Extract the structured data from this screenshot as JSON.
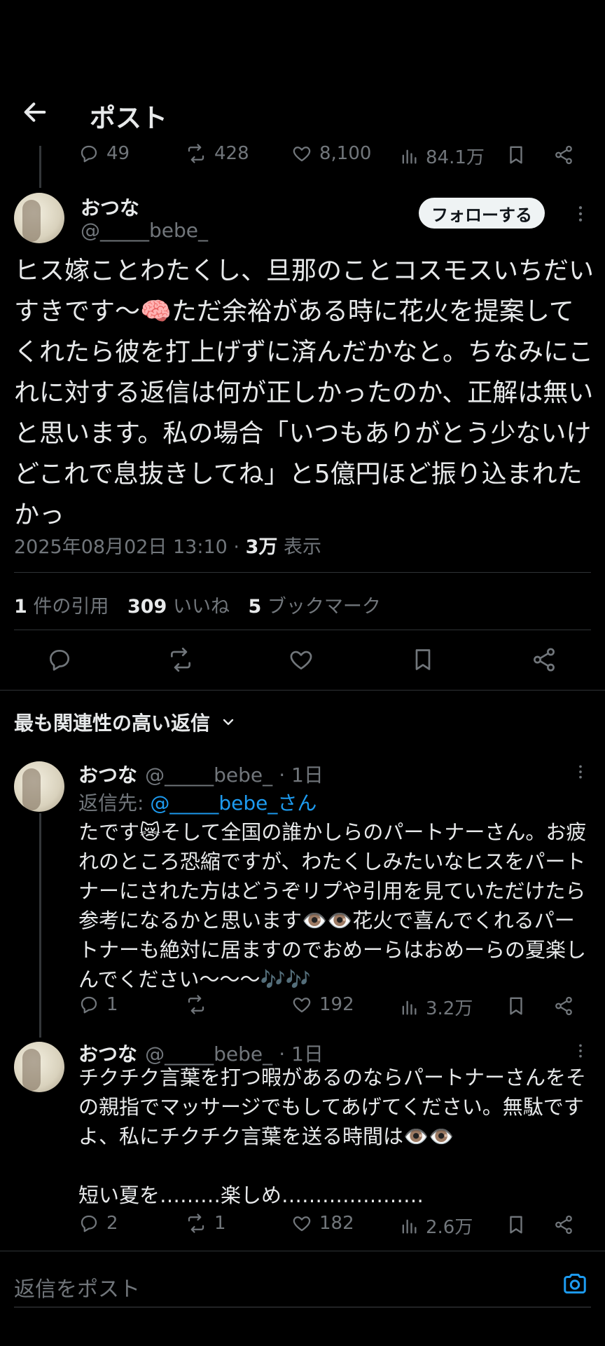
{
  "header": {
    "title": "ポスト"
  },
  "top_stats": {
    "replies": "49",
    "reposts": "428",
    "likes": "8,100",
    "views": "84.1万"
  },
  "post": {
    "name": "おつな",
    "handle": "@_____bebe_",
    "follow_label": "フォローする",
    "text": "ヒス嫁ことわたくし、旦那のことコスモスいちだいすきです〜🧠ただ余裕がある時に花火を提案してくれたら彼を打上げずに済んだかなと。ちなみにこれに対する返信は何が正しかったのか、正解は無いと思います。私の場合「いつもありがとう少ないけどこれで息抜きしてね」と5億円ほど振り込まれたかっ",
    "date": "2025年08月02日 13:10 · ",
    "views_count": "3万",
    "views_label": " 表示"
  },
  "engagement": {
    "quotes_count": "1",
    "quotes_label": " 件の引用",
    "likes_count": "309",
    "likes_label": " いいね",
    "bookmarks_count": "5",
    "bookmarks_label": " ブックマーク"
  },
  "sort": {
    "label": "最も関連性の高い返信"
  },
  "replies": [
    {
      "name": "おつな",
      "handle": "@_____bebe_",
      "time": "· 1日",
      "reply_to_prefix": "返信先: ",
      "reply_to_handle": "@_____bebe_さん",
      "text": "たです😿そして全国の誰かしらのパートナーさん。お疲れのところ恐縮ですが、わたくしみたいなヒスをパートナーにされた方はどうぞリプや引用を見ていただけたら参考になるかと思います👁️👁️花火で喜んでくれるパートナーも絶対に居ますのでおめーらはおめーらの夏楽しんでください〜〜〜🎶🎶",
      "stats": {
        "replies": "1",
        "reposts": "",
        "likes": "192",
        "views": "3.2万"
      }
    },
    {
      "name": "おつな",
      "handle": "@_____bebe_",
      "time": "· 1日",
      "text": "チクチク言葉を打つ暇があるのならパートナーさんをその親指でマッサージでもしてあげてください。無駄ですよ、私にチクチク言葉を送る時間は👁️👁️\n\n短い夏を………楽しめ…………………",
      "stats": {
        "replies": "2",
        "reposts": "1",
        "likes": "182",
        "views": "2.6万"
      }
    }
  ],
  "composer": {
    "placeholder": "返信をポスト"
  },
  "colors": {
    "background": "#000000",
    "text": "#e7e9ea",
    "muted": "#71767b",
    "link": "#1d9bf0",
    "divider": "#2f3336"
  }
}
